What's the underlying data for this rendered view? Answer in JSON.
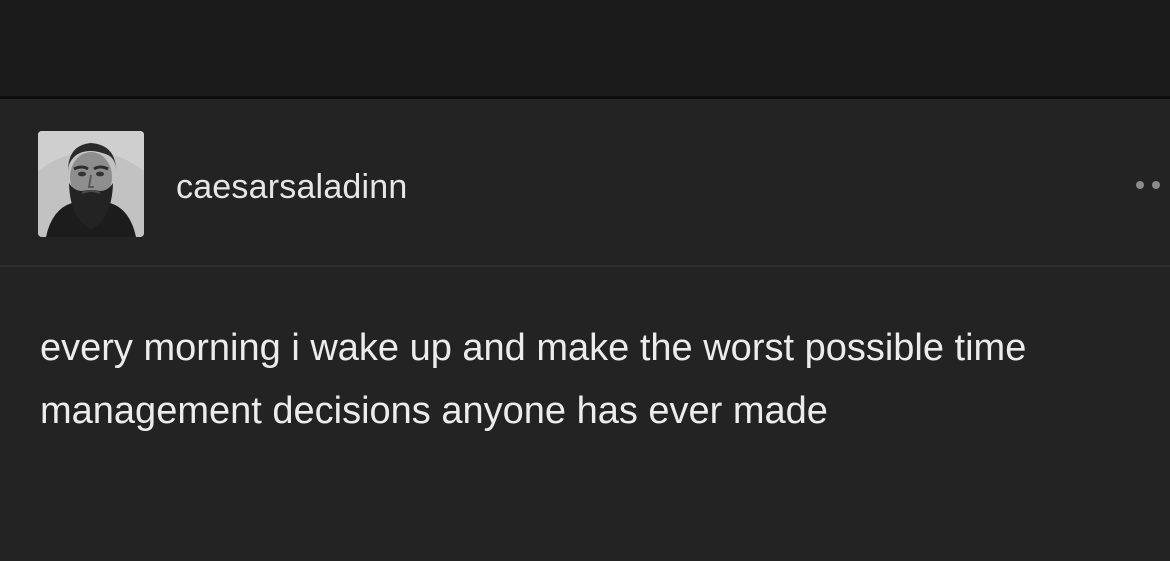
{
  "post": {
    "username": "caesarsaladinn",
    "avatar_icon": "bearded-man-portrait-icon",
    "more_icon": "ellipsis-icon",
    "text": "every morning i wake up and make the worst possible time management decisions anyone has ever made"
  },
  "colors": {
    "background": "#202021",
    "top_strip": "#1b1b1c",
    "text": "#ececec",
    "muted": "#8a8a8a"
  }
}
